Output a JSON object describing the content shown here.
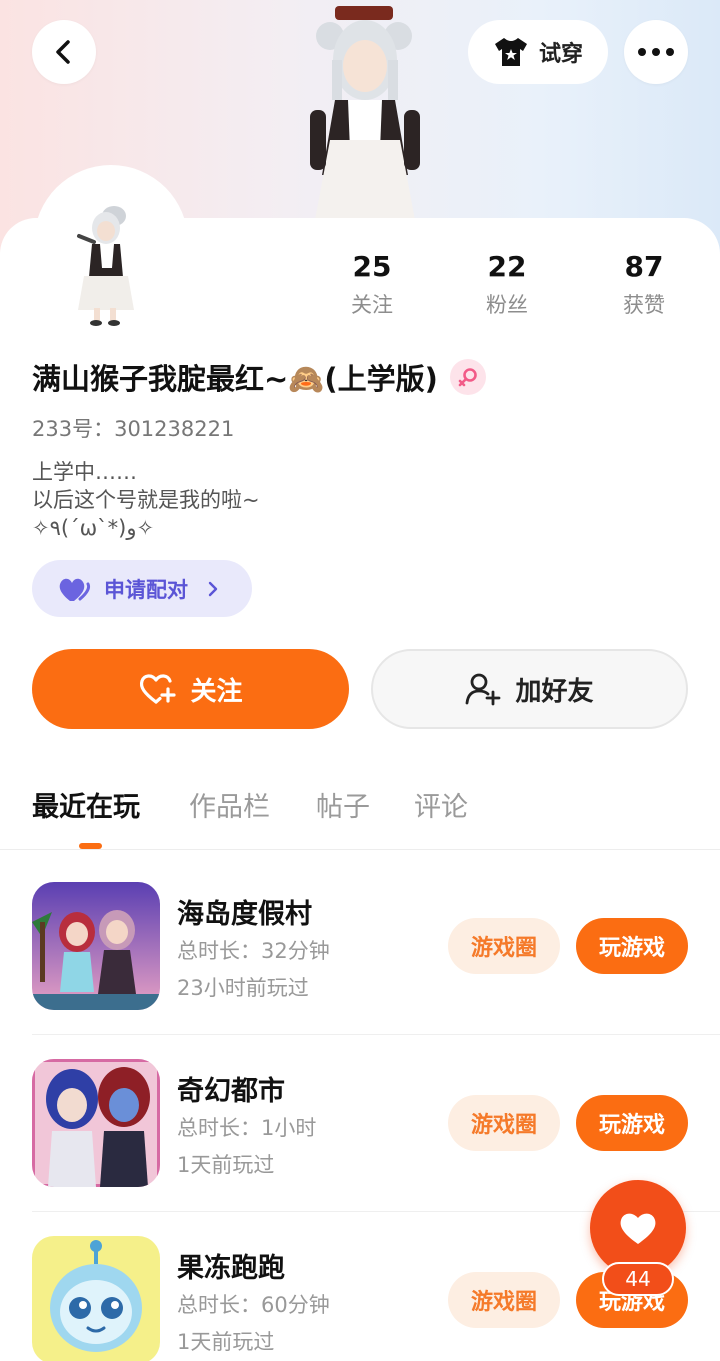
{
  "header": {
    "try_on_label": "试穿",
    "back_icon": "chevron-left-icon",
    "more_icon": "more-dots-icon",
    "try_on_icon": "tshirt-icon"
  },
  "profile": {
    "stats": [
      {
        "value": "25",
        "label": "关注"
      },
      {
        "value": "22",
        "label": "粉丝"
      },
      {
        "value": "87",
        "label": "获赞"
      }
    ],
    "name": "满山猴子我腚最红~🙈(上学版)",
    "gender": "female",
    "uid": "233号：301238221",
    "bio_lines": [
      "上学中……",
      "以后这个号就是我的啦~",
      "✧٩(ˊωˋ*)و✧"
    ],
    "match_label": "申请配对",
    "follow_label": "关注",
    "add_friend_label": "加好友"
  },
  "tabs": [
    {
      "label": "最近在玩",
      "active": true
    },
    {
      "label": "作品栏",
      "active": false
    },
    {
      "label": "帖子",
      "active": false
    },
    {
      "label": "评论",
      "active": false
    }
  ],
  "games": [
    {
      "title": "海岛度假村",
      "duration": "总时长：32分钟",
      "last_played": "23小时前玩过",
      "circle_label": "游戏圈",
      "play_label": "玩游戏"
    },
    {
      "title": "奇幻都市",
      "duration": "总时长：1小时",
      "last_played": "1天前玩过",
      "circle_label": "游戏圈",
      "play_label": "玩游戏"
    },
    {
      "title": "果冻跑跑",
      "duration": "总时长：60分钟",
      "last_played": "1天前玩过",
      "circle_label": "游戏圈",
      "play_label": "玩游戏"
    }
  ],
  "like_fab": {
    "count": "44"
  },
  "colors": {
    "accent": "#fb6d12",
    "match": "#5b55d6",
    "like": "#f24e19"
  }
}
